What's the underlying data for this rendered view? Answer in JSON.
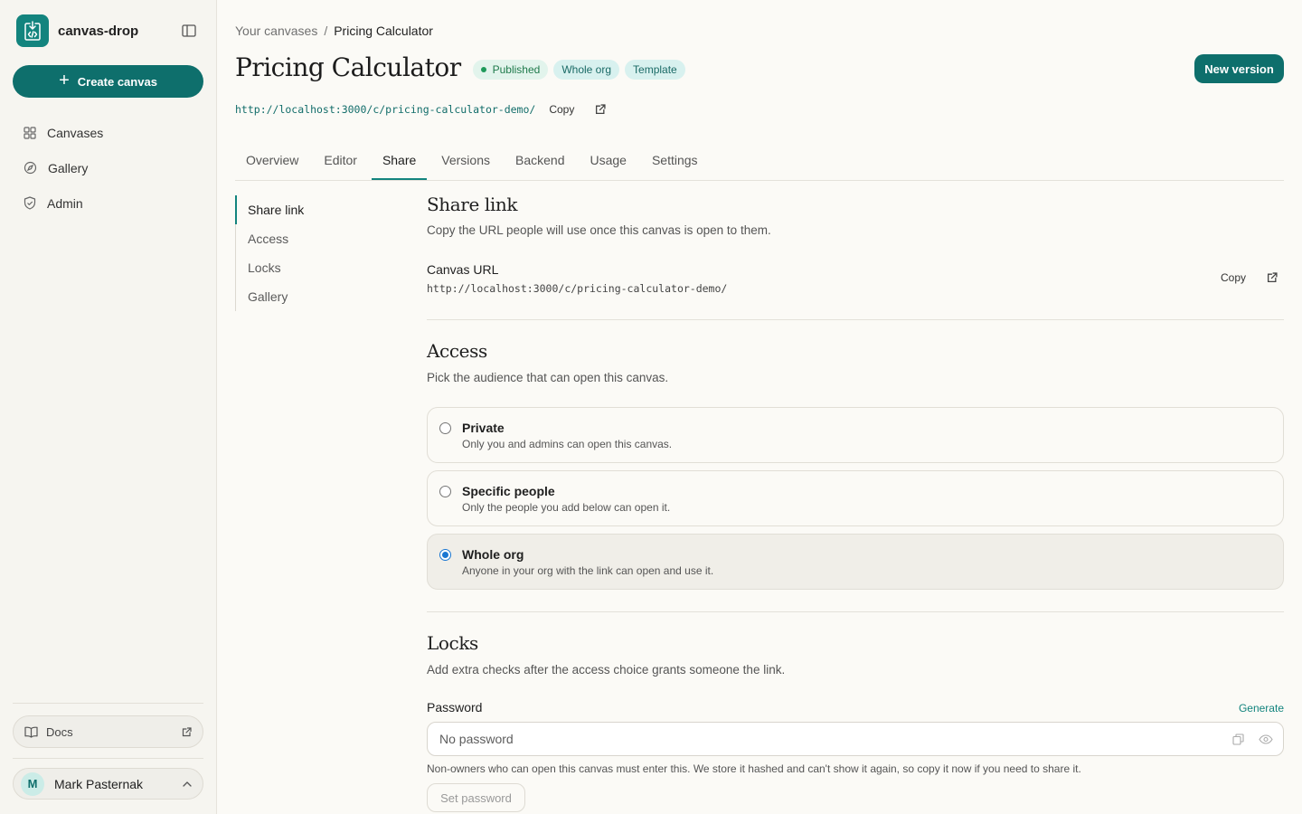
{
  "sidebar": {
    "brand_name": "canvas-drop",
    "create_label": "Create canvas",
    "nav": [
      {
        "label": "Canvases",
        "icon": "grid-icon"
      },
      {
        "label": "Gallery",
        "icon": "compass-icon"
      },
      {
        "label": "Admin",
        "icon": "shield-icon"
      }
    ],
    "docs_label": "Docs",
    "user": {
      "initial": "M",
      "name": "Mark Pasternak"
    }
  },
  "header": {
    "breadcrumb_root": "Your canvases",
    "breadcrumb_sep": "/",
    "breadcrumb_current": "Pricing Calculator",
    "title": "Pricing Calculator",
    "badges": {
      "published": "Published",
      "whole_org": "Whole org",
      "template": "Template"
    },
    "new_version_label": "New version",
    "url": "http://localhost:3000/c/pricing-calculator-demo/",
    "copy_label": "Copy"
  },
  "tabs": [
    "Overview",
    "Editor",
    "Share",
    "Versions",
    "Backend",
    "Usage",
    "Settings"
  ],
  "active_tab": "Share",
  "subnav": [
    "Share link",
    "Access",
    "Locks",
    "Gallery"
  ],
  "share_link": {
    "title": "Share link",
    "desc": "Copy the URL people will use once this canvas is open to them.",
    "field_label": "Canvas URL",
    "url": "http://localhost:3000/c/pricing-calculator-demo/",
    "copy_label": "Copy"
  },
  "access": {
    "title": "Access",
    "desc": "Pick the audience that can open this canvas.",
    "options": [
      {
        "title": "Private",
        "desc": "Only you and admins can open this canvas.",
        "selected": false
      },
      {
        "title": "Specific people",
        "desc": "Only the people you add below can open it.",
        "selected": false
      },
      {
        "title": "Whole org",
        "desc": "Anyone in your org with the link can open and use it.",
        "selected": true
      }
    ]
  },
  "locks": {
    "title": "Locks",
    "desc": "Add extra checks after the access choice grants someone the link.",
    "password_label": "Password",
    "generate_label": "Generate",
    "password_placeholder": "No password",
    "hint": "Non-owners who can open this canvas must enter this. We store it hashed and can't show it again, so copy it now if you need to share it.",
    "set_password_label": "Set password"
  },
  "colors": {
    "accent": "#0e6f6c",
    "accent_light": "#13847e",
    "published_bg": "#e2f4ec",
    "tag_bg": "#d8f1ef"
  }
}
